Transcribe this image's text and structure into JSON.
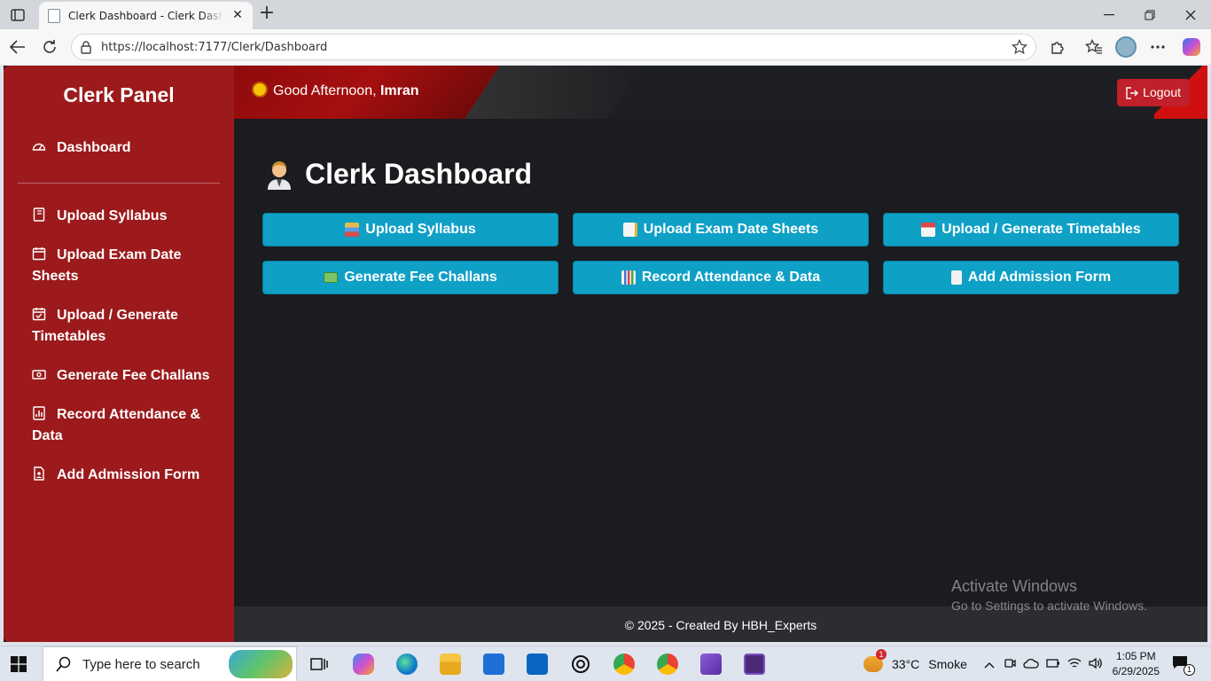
{
  "browser": {
    "tab_title": "Clerk Dashboard - Clerk Dashboard",
    "url": "https://localhost:7177/Clerk/Dashboard"
  },
  "sidebar": {
    "brand": "Clerk Panel",
    "items": [
      {
        "label": "Dashboard",
        "icon": "gauge-icon"
      },
      {
        "label": "Upload Syllabus",
        "icon": "book-icon"
      },
      {
        "label": "Upload Exam Date Sheets",
        "icon": "calendar-icon"
      },
      {
        "label": "Upload / Generate Timetables",
        "icon": "calendar-check-icon"
      },
      {
        "label": "Generate Fee Challans",
        "icon": "cash-icon"
      },
      {
        "label": "Record Attendance & Data",
        "icon": "chart-icon"
      },
      {
        "label": "Add Admission Form",
        "icon": "document-person-icon"
      }
    ]
  },
  "header": {
    "greeting": "Good Afternoon,",
    "user": "Imran",
    "logout": "Logout"
  },
  "main": {
    "title": "Clerk Dashboard",
    "actions": [
      {
        "label": "Upload Syllabus",
        "icon": "books-icon"
      },
      {
        "label": "Upload Exam Date Sheets",
        "icon": "memo-icon"
      },
      {
        "label": "Upload / Generate Timetables",
        "icon": "calendar-icon"
      },
      {
        "label": "Generate Fee Challans",
        "icon": "money-icon"
      },
      {
        "label": "Record Attendance & Data",
        "icon": "bar-chart-icon"
      },
      {
        "label": "Add Admission Form",
        "icon": "receipt-icon"
      }
    ]
  },
  "footer": {
    "text": "© 2025 - Created By HBH_Experts"
  },
  "watermark": {
    "line1": "Activate Windows",
    "line2": "Go to Settings to activate Windows."
  },
  "taskbar": {
    "search_placeholder": "Type here to search",
    "weather_temp": "33°C",
    "weather_text": "Smoke",
    "weather_badge": "1",
    "time": "1:05 PM",
    "date": "6/29/2025",
    "notification_count": "1"
  },
  "colors": {
    "sidebar": "#9c1a1c",
    "content_bg": "#1a1c1f",
    "action_button": "#0fa0c6",
    "logout_button": "#c0202a"
  }
}
